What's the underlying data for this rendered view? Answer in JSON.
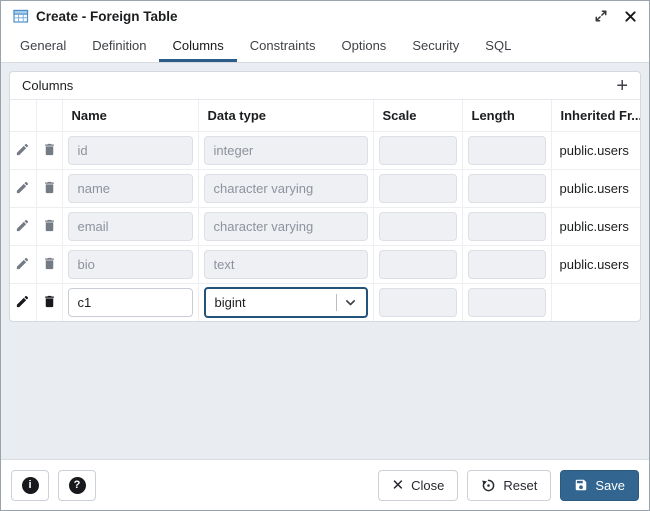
{
  "window": {
    "title": "Create - Foreign Table"
  },
  "tabs": [
    {
      "label": "General"
    },
    {
      "label": "Definition"
    },
    {
      "label": "Columns"
    },
    {
      "label": "Constraints"
    },
    {
      "label": "Options"
    },
    {
      "label": "Security"
    },
    {
      "label": "SQL"
    }
  ],
  "active_tab": "Columns",
  "columns_panel": {
    "title": "Columns",
    "add_button": "+",
    "table": {
      "headers": {
        "name": "Name",
        "data_type": "Data type",
        "scale": "Scale",
        "length": "Length",
        "inherited_from": "Inherited Fr..."
      },
      "rows": [
        {
          "name": "id",
          "data_type": "integer",
          "scale": "",
          "length": "",
          "inherited_from": "public.users"
        },
        {
          "name": "name",
          "data_type": "character varying",
          "scale": "",
          "length": "",
          "inherited_from": "public.users"
        },
        {
          "name": "email",
          "data_type": "character varying",
          "scale": "",
          "length": "",
          "inherited_from": "public.users"
        },
        {
          "name": "bio",
          "data_type": "text",
          "scale": "",
          "length": "",
          "inherited_from": "public.users"
        },
        {
          "name": "c1",
          "data_type": "bigint",
          "scale": "",
          "length": "",
          "inherited_from": ""
        }
      ]
    }
  },
  "footer": {
    "info_glyph": "i",
    "help_glyph": "?",
    "close_x": "✕",
    "close": "Close",
    "reset": "Reset",
    "save": "Save"
  },
  "icons": {
    "title": "table-icon",
    "maximize": "expand-diagonal-icon",
    "titlebar_close": "close-x-icon",
    "row_edit": "pencil-icon",
    "row_delete": "trash-icon",
    "dropdown": "chevron-down-icon",
    "reset": "restore-arrow-icon",
    "save": "floppy-disk-icon"
  },
  "colors": {
    "primary": "#326690",
    "tab_underline": "#2c5c8a",
    "dialog_bg": "#e9ecf1",
    "panel_bg": "#ffffff",
    "disabled_input_bg": "#eef0f4",
    "focus_border": "#24537a"
  }
}
